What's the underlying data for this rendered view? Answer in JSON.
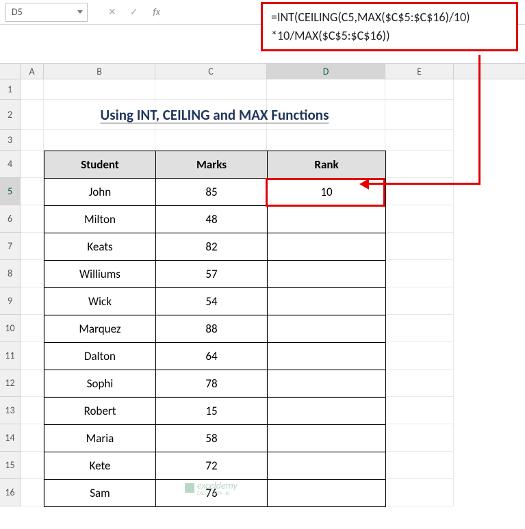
{
  "toolbar": {
    "cell_reference": "D5",
    "fx_label": "fx",
    "formula_line1": "=INT(CEILING(C5,MAX($C$5:$C$16)/10)",
    "formula_line2": "*10/MAX($C$5:$C$16))"
  },
  "columns": {
    "A": "A",
    "B": "B",
    "C": "C",
    "D": "D",
    "E": "E"
  },
  "rows": [
    "1",
    "2",
    "3",
    "4",
    "5",
    "6",
    "7",
    "8",
    "9",
    "10",
    "11",
    "12",
    "13",
    "14",
    "15",
    "16"
  ],
  "title": "Using INT, CEILING and MAX Functions",
  "headers": {
    "student": "Student",
    "marks": "Marks",
    "rank": "Rank"
  },
  "data": [
    {
      "student": "John",
      "marks": "85",
      "rank": "10"
    },
    {
      "student": "Milton",
      "marks": "48",
      "rank": ""
    },
    {
      "student": "Keats",
      "marks": "82",
      "rank": ""
    },
    {
      "student": "Williums",
      "marks": "57",
      "rank": ""
    },
    {
      "student": "Wick",
      "marks": "54",
      "rank": ""
    },
    {
      "student": "Marquez",
      "marks": "88",
      "rank": ""
    },
    {
      "student": "Dalton",
      "marks": "64",
      "rank": ""
    },
    {
      "student": "Sophi",
      "marks": "78",
      "rank": ""
    },
    {
      "student": "Robert",
      "marks": "15",
      "rank": ""
    },
    {
      "student": "Maria",
      "marks": "58",
      "rank": ""
    },
    {
      "student": "Kete",
      "marks": "72",
      "rank": ""
    },
    {
      "student": "Sam",
      "marks": "76",
      "rank": ""
    }
  ],
  "watermark": {
    "brand": "exceldemy",
    "sub": "EXCEL · DATA · BI"
  }
}
